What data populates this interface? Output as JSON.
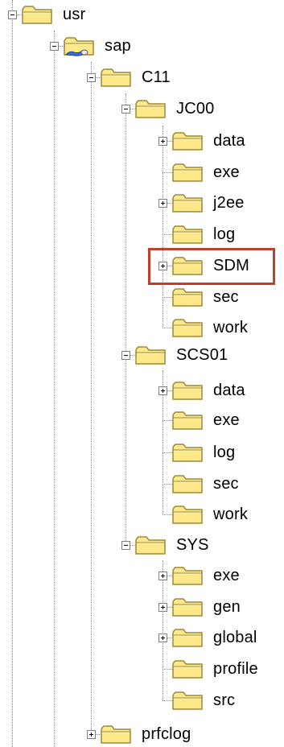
{
  "tree": {
    "nodes": [
      {
        "label": "usr",
        "toggle": "minus",
        "icon": "folder-icon"
      },
      {
        "label": "sap",
        "toggle": "minus",
        "icon": "shared-folder-icon"
      },
      {
        "label": "C11",
        "toggle": "minus",
        "icon": "folder-icon"
      },
      {
        "label": "JC00",
        "toggle": "minus",
        "icon": "folder-icon"
      },
      {
        "label": "data",
        "toggle": "plus",
        "icon": "folder-icon"
      },
      {
        "label": "exe",
        "toggle": "none",
        "icon": "folder-icon"
      },
      {
        "label": "j2ee",
        "toggle": "plus",
        "icon": "folder-icon"
      },
      {
        "label": "log",
        "toggle": "none",
        "icon": "folder-icon"
      },
      {
        "label": "SDM",
        "toggle": "plus",
        "icon": "folder-icon",
        "highlighted": true
      },
      {
        "label": "sec",
        "toggle": "none",
        "icon": "folder-icon"
      },
      {
        "label": "work",
        "toggle": "none",
        "icon": "folder-icon"
      },
      {
        "label": "SCS01",
        "toggle": "minus",
        "icon": "folder-icon"
      },
      {
        "label": "data",
        "toggle": "plus",
        "icon": "folder-icon"
      },
      {
        "label": "exe",
        "toggle": "none",
        "icon": "folder-icon"
      },
      {
        "label": "log",
        "toggle": "none",
        "icon": "folder-icon"
      },
      {
        "label": "sec",
        "toggle": "none",
        "icon": "folder-icon"
      },
      {
        "label": "work",
        "toggle": "none",
        "icon": "folder-icon"
      },
      {
        "label": "SYS",
        "toggle": "minus",
        "icon": "folder-icon"
      },
      {
        "label": "exe",
        "toggle": "plus",
        "icon": "folder-icon"
      },
      {
        "label": "gen",
        "toggle": "plus",
        "icon": "folder-icon"
      },
      {
        "label": "global",
        "toggle": "plus",
        "icon": "folder-icon"
      },
      {
        "label": "profile",
        "toggle": "none",
        "icon": "folder-icon"
      },
      {
        "label": "src",
        "toggle": "none",
        "icon": "folder-icon"
      },
      {
        "label": "prfclog",
        "toggle": "plus",
        "icon": "folder-icon"
      }
    ]
  },
  "colors": {
    "folder_fill": "#ffe88a",
    "folder_stroke": "#9a8a3a",
    "highlight_border": "#c0412b",
    "connector": "#8a8a8a"
  }
}
